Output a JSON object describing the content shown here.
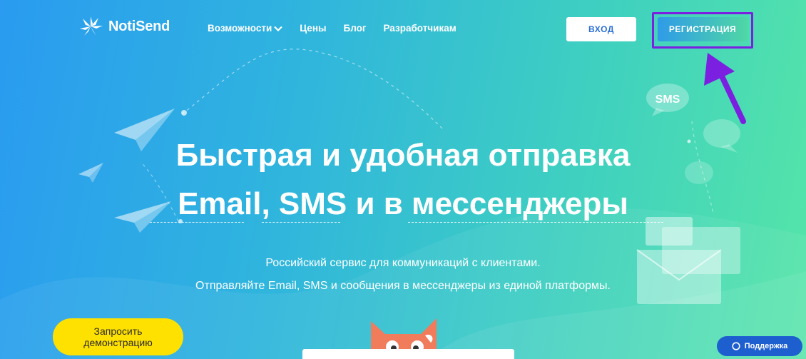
{
  "header": {
    "logo_text": "NotiSend",
    "nav": [
      {
        "label": "Возможности",
        "has_dropdown": true
      },
      {
        "label": "Цены"
      },
      {
        "label": "Блог"
      },
      {
        "label": "Разработчикам"
      }
    ],
    "login_label": "ВХОД",
    "register_label": "РЕГИСТРАЦИЯ"
  },
  "hero": {
    "title_line1": "Быстрая и удобная отправка",
    "title_line2": "Email, SMS и в мессенджеры",
    "subtitle_line1": "Российский сервис для коммуникаций с клиентами.",
    "subtitle_line2": "Отправляйте Email, SMS и сообщения в мессенджеры из единой платформы.",
    "sms_bubble": "SMS"
  },
  "cta": {
    "demo_label": "Запросить демонстрацию"
  },
  "support": {
    "label": "Поддержка"
  },
  "colors": {
    "gradient_start": "#2a9bf0",
    "gradient_end": "#55e5a8",
    "highlight_border": "#7b1fe0",
    "demo_button": "#ffe100",
    "support_button": "#1e5fd0"
  },
  "icons": [
    "logo-burst-icon",
    "chevron-down-icon",
    "paper-plane-icon",
    "chat-bubble-icon",
    "envelope-icon",
    "cat-mascot-icon",
    "arrow-pointer-icon"
  ]
}
